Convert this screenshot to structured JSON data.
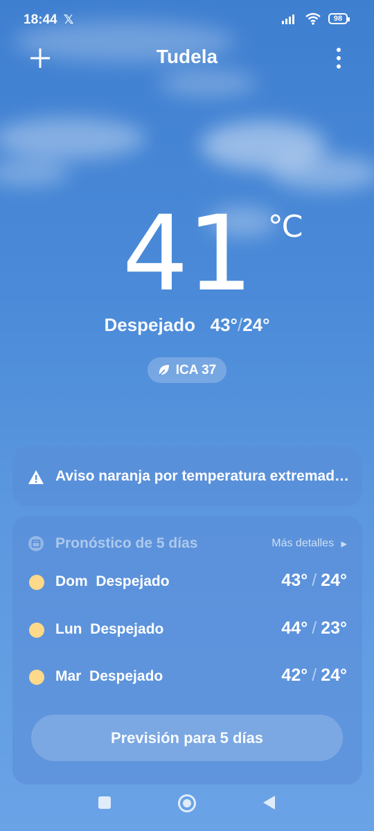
{
  "status_bar": {
    "time": "18:44",
    "battery": "98"
  },
  "header": {
    "city": "Tudela"
  },
  "current": {
    "temperature": "41",
    "unit": "°C",
    "condition": "Despejado",
    "high": "43°",
    "low": "24°",
    "aqi_label": "ICA 37"
  },
  "alert": {
    "text": "Aviso naranja por temperatura extremad…"
  },
  "forecast": {
    "title": "Pronóstico de 5 días",
    "more_label": "Más detalles",
    "days": [
      {
        "day": "Dom",
        "condition": "Despejado",
        "high": "43°",
        "low": "24°"
      },
      {
        "day": "Lun",
        "condition": "Despejado",
        "high": "44°",
        "low": "23°"
      },
      {
        "day": "Mar",
        "condition": "Despejado",
        "high": "42°",
        "low": "24°"
      }
    ],
    "button_label": "Previsión para 5 días"
  },
  "colors": {
    "sky_top": "#3f7fd0",
    "sky_bottom": "#6aa3e6",
    "sun_dot": "#ffd98a"
  }
}
